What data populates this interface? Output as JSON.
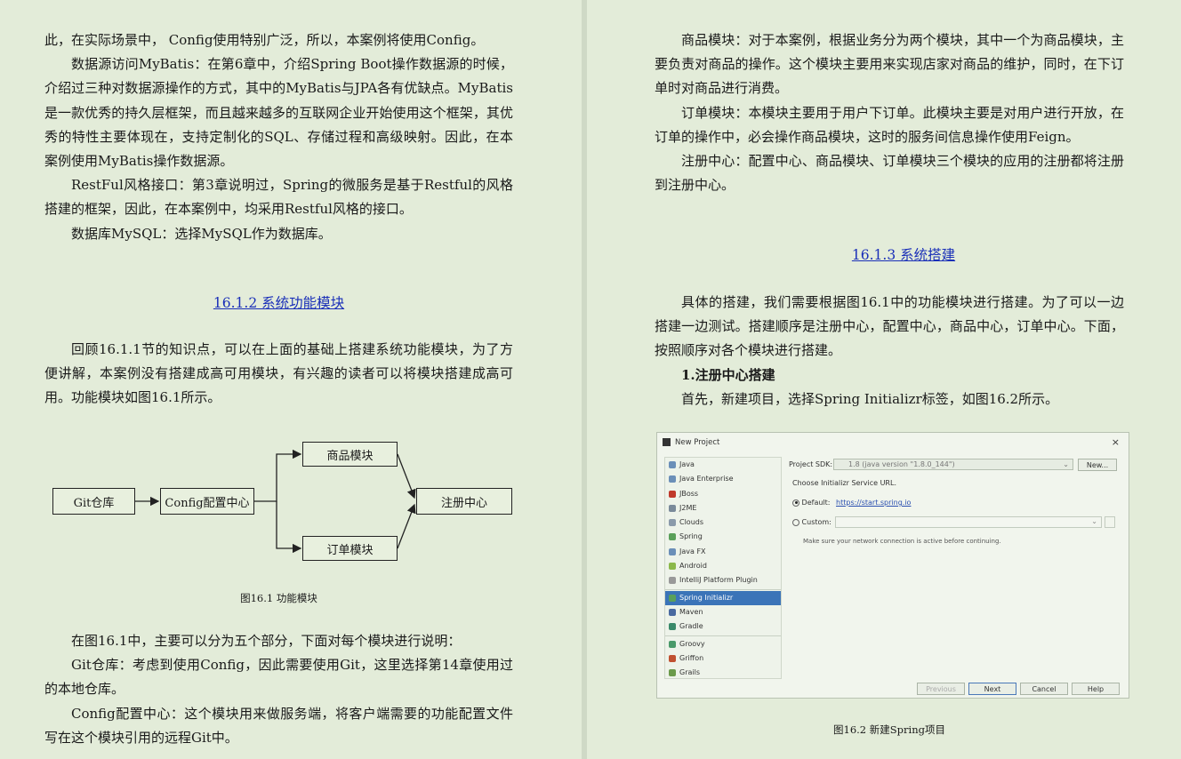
{
  "left": {
    "paragraphs": [
      "此，在实际场景中， Config使用特别广泛，所以，本案例将使用Config。",
      "数据源访问MyBatis：在第6章中，介绍Spring Boot操作数据源的时候，介绍过三种对数据源操作的方式，其中的MyBatis与JPA各有优缺点。MyBatis是一款优秀的持久层框架，而且越来越多的互联网企业开始使用这个框架，其优秀的特性主要体现在，支持定制化的SQL、存储过程和高级映射。因此，在本案例使用MyBatis操作数据源。",
      "RestFul风格接口：第3章说明过，Spring的微服务是基于Restful的风格搭建的框架，因此，在本案例中，均采用Restful风格的接口。",
      "数据库MySQL：选择MySQL作为数据库。"
    ],
    "heading": "16.1.2 系统功能模块",
    "intro": "回顾16.1.1节的知识点，可以在上面的基础上搭建系统功能模块，为了方便讲解，本案例没有搭建成高可用模块，有兴趣的读者可以将模块搭建成高可用。功能模块如图16.1所示。",
    "diagram": {
      "git": "Git仓库",
      "config": "Config配置中心",
      "product": "商品模块",
      "order": "订单模块",
      "registry": "注册中心"
    },
    "caption": "图16.1  功能模块",
    "after": [
      "在图16.1中，主要可以分为五个部分，下面对每个模块进行说明：",
      "Git仓库：考虑到使用Config，因此需要使用Git，这里选择第14章使用过的本地仓库。",
      "Config配置中心：这个模块用来做服务端，将客户端需要的功能配置文件写在这个模块引用的远程Git中。"
    ]
  },
  "right": {
    "paragraphs": [
      "商品模块：对于本案例，根据业务分为两个模块，其中一个为商品模块，主要负责对商品的操作。这个模块主要用来实现店家对商品的维护，同时，在下订单时对商品进行消费。",
      "订单模块：本模块主要用于用户下订单。此模块主要是对用户进行开放，在订单的操作中，必会操作商品模块，这时的服务间信息操作使用Feign。",
      "注册中心：配置中心、商品模块、订单模块三个模块的应用的注册都将注册到注册中心。"
    ],
    "heading": "16.1.3 系统搭建",
    "intro": "具体的搭建，我们需要根据图16.1中的功能模块进行搭建。为了可以一边搭建一边测试。搭建顺序是注册中心，配置中心，商品中心，订单中心。下面，按照顺序对各个模块进行搭建。",
    "subheading": "1.注册中心搭建",
    "step": "首先，新建项目，选择Spring Initializr标签，如图16.2所示。",
    "caption": "图16.2  新建Spring项目"
  },
  "dialog": {
    "title": "New Project",
    "close": "×",
    "sidebar": [
      "Java",
      "Java Enterprise",
      "JBoss",
      "J2ME",
      "Clouds",
      "Spring",
      "Java FX",
      "Android",
      "IntelliJ Platform Plugin",
      "Spring Initializr",
      "Maven",
      "Gradle",
      "Groovy",
      "Griffon",
      "Grails"
    ],
    "selected": "Spring Initializr",
    "sdk_label": "Project SDK:",
    "sdk_value": "1.8 (java version \"1.8.0_144\")",
    "new_btn": "New...",
    "choose_label": "Choose Initializr Service URL.",
    "default_label": "Default:",
    "default_url": "https://start.spring.io",
    "custom_label": "Custom:",
    "note": "Make sure your network connection is active before continuing.",
    "buttons": [
      "Previous",
      "Next",
      "Cancel",
      "Help"
    ]
  },
  "colors": {
    "link": "#1a2fb8",
    "page_bg": "#e3ecd9",
    "selection": "#3b74b8"
  }
}
